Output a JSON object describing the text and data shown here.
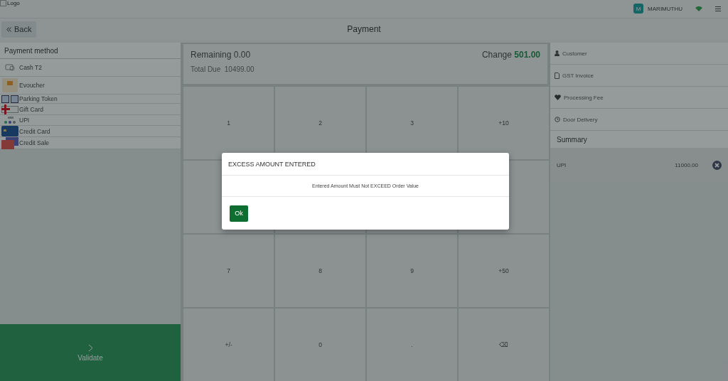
{
  "header": {
    "logo_alt": "Logo",
    "user": {
      "initial": "M",
      "name": "MARIMUTHU"
    }
  },
  "toolbar": {
    "back": "Back",
    "title": "Payment"
  },
  "payment_methods": {
    "title": "Payment method",
    "items": [
      {
        "label": "Cash T2",
        "kind": "cash"
      },
      {
        "label": "Evoucher",
        "kind": "voucher"
      },
      {
        "label": "Parking Token",
        "kind": "parking"
      },
      {
        "label": "Gift Card",
        "kind": "gift"
      },
      {
        "label": "UPI",
        "kind": "upi"
      },
      {
        "label": "Credit Card",
        "kind": "card"
      },
      {
        "label": "Credit Sale",
        "kind": "sale"
      }
    ]
  },
  "validate": "Validate",
  "totals": {
    "remaining_label": "Remaining",
    "remaining": "0.00",
    "change_label": "Change",
    "change": "501.00",
    "total_due_label": "Total Due",
    "total_due": "10499.00"
  },
  "keypad": [
    {
      "kind": "key",
      "label": "1"
    },
    {
      "kind": "key",
      "label": "2"
    },
    {
      "kind": "key",
      "label": "3"
    },
    {
      "kind": "key",
      "label": "+10"
    },
    {
      "kind": "covered"
    },
    {
      "kind": "covered"
    },
    {
      "kind": "covered"
    },
    {
      "kind": "covered"
    },
    {
      "kind": "key",
      "label": "7"
    },
    {
      "kind": "key",
      "label": "8"
    },
    {
      "kind": "key",
      "label": "9"
    },
    {
      "kind": "key",
      "label": "+50"
    },
    {
      "kind": "key",
      "label": "+/-"
    },
    {
      "kind": "key",
      "label": "0"
    },
    {
      "kind": "key",
      "label": "."
    },
    {
      "kind": "key",
      "label": "⌫"
    }
  ],
  "options": [
    {
      "label": "Customer",
      "kind": "user"
    },
    {
      "label": "GST Invoice",
      "kind": "file"
    },
    {
      "label": "Processing Fee",
      "kind": "heart"
    },
    {
      "label": "Door Delivery",
      "kind": "clock"
    }
  ],
  "summary": {
    "title": "Summary",
    "lines": [
      {
        "method": "UPI",
        "amount": "11000.00"
      }
    ]
  },
  "dialog": {
    "title": "EXCESS AMOUNT ENTERED",
    "message": "Entered Amount Must Not EXCEED Order Value",
    "button": "Ok"
  }
}
